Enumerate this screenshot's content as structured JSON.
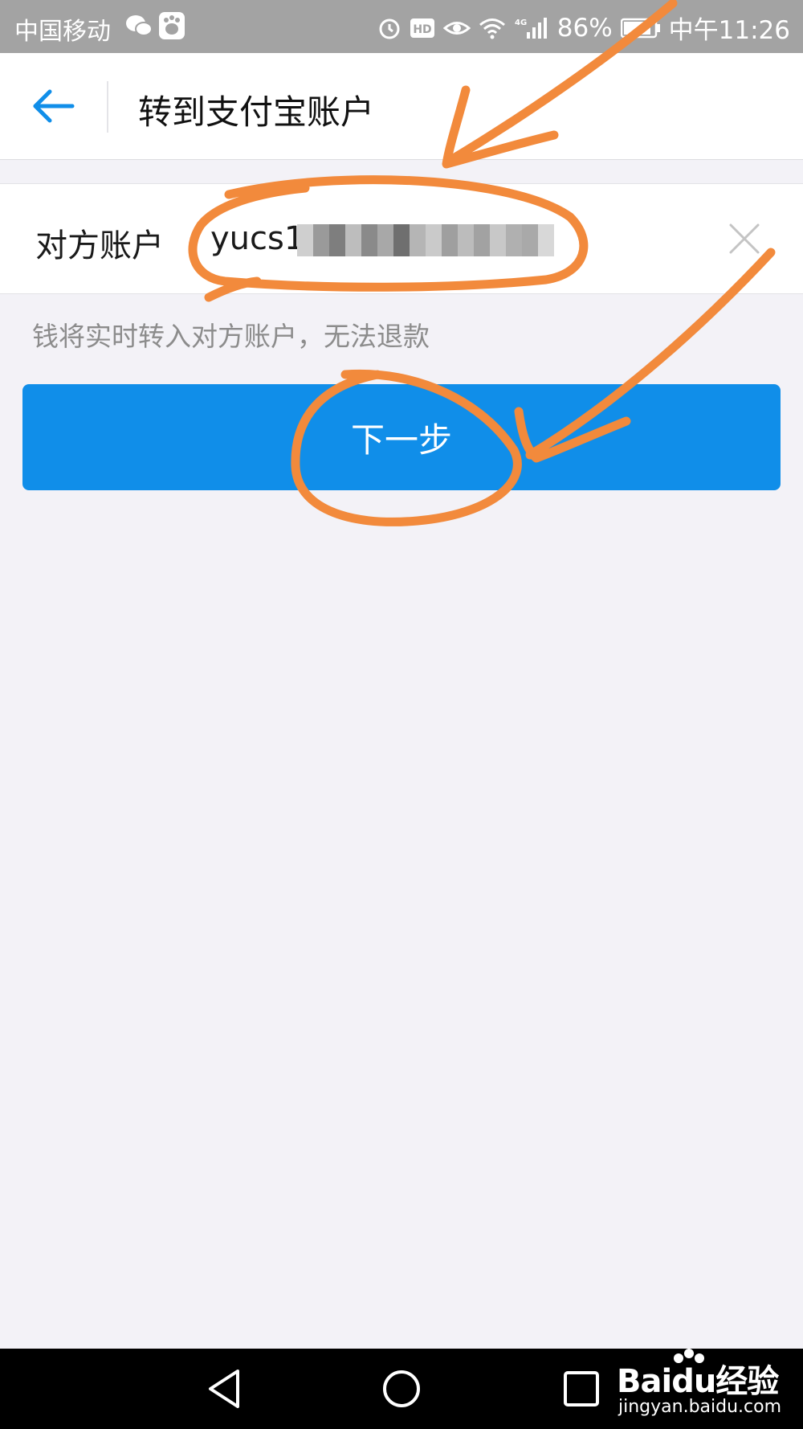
{
  "status_bar": {
    "carrier": "中国移动",
    "battery_percent": "86%",
    "time": "中午11:26",
    "icons": [
      "chat-icon",
      "paw-icon",
      "alarm-icon",
      "hd-icon",
      "eye-icon",
      "wifi-icon",
      "4g-signal-icon",
      "battery-icon"
    ]
  },
  "header": {
    "back_icon": "arrow-left-icon",
    "title": "转到支付宝账户"
  },
  "account_row": {
    "label": "对方账户",
    "value": "yucs1",
    "clear_icon": "close-icon"
  },
  "notice": "钱将实时转入对方账户，无法退款",
  "next_button": "下一步",
  "nav_bar": {
    "icons": [
      "back-triangle-icon",
      "home-circle-icon",
      "recents-square-icon"
    ]
  },
  "watermark": {
    "brand": "Baidu经验",
    "domain": "jingyan.baidu.com"
  },
  "colors": {
    "accent": "#108ee9",
    "annotation": "#f28a3c",
    "background": "#f3f2f7"
  }
}
